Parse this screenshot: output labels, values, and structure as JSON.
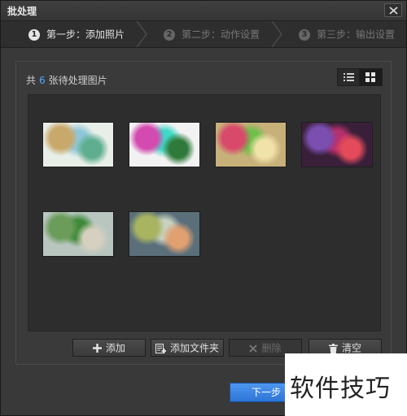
{
  "window": {
    "title": "批处理"
  },
  "steps": [
    {
      "num": "1",
      "label": "第一步：添加照片",
      "active": true
    },
    {
      "num": "2",
      "label": "第二步：动作设置",
      "active": false
    },
    {
      "num": "3",
      "label": "第三步：输出设置",
      "active": false
    }
  ],
  "summary": {
    "prefix": "共",
    "count": "6",
    "suffix": "张待处理图片"
  },
  "view_modes": [
    "list-view-icon",
    "grid-view-icon"
  ],
  "thumbnails": [
    {
      "name": "thumbnail-1",
      "colors": [
        "#e8eee8",
        "#8fc7d8",
        "#c9a86b",
        "#5fae8f"
      ]
    },
    {
      "name": "thumbnail-2",
      "colors": [
        "#f2f2f2",
        "#3fd9c8",
        "#d34ab0",
        "#2f7a3a"
      ]
    },
    {
      "name": "thumbnail-3",
      "colors": [
        "#c8b07a",
        "#6fbf4a",
        "#d94a6a",
        "#f0e2a8"
      ]
    },
    {
      "name": "thumbnail-4",
      "colors": [
        "#3a1f3a",
        "#b6306e",
        "#7a4fb0",
        "#e34a5a"
      ]
    },
    {
      "name": "thumbnail-5",
      "colors": [
        "#b9c6c0",
        "#3f8a3a",
        "#6b9c5a",
        "#d6d0c0"
      ]
    },
    {
      "name": "thumbnail-6",
      "colors": [
        "#5a6f7a",
        "#c8d0c0",
        "#a8b460",
        "#e0a070"
      ]
    }
  ],
  "actions": {
    "add": "添加",
    "add_folder": "添加文件夹",
    "delete": "删除",
    "clear": "清空"
  },
  "footer": {
    "next": "下一步"
  },
  "watermark": {
    "text": "软件技巧"
  }
}
